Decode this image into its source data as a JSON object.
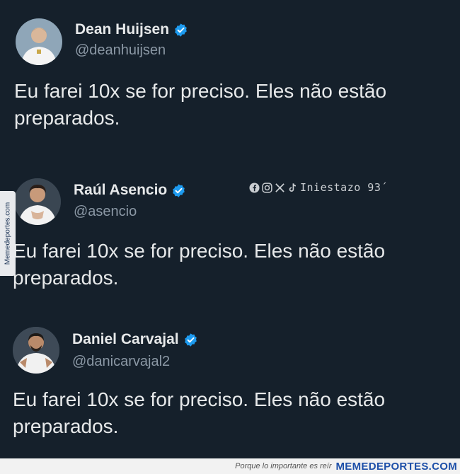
{
  "tweets": [
    {
      "name": "Dean Huijsen",
      "handle": "@deanhuijsen",
      "text": "Eu farei 10x se for preciso. Eles não estão preparados."
    },
    {
      "name": "Raúl Asencio",
      "handle": "@asencio",
      "text": "Eu farei 10x se for preciso. Eles não estão preparados."
    },
    {
      "name": "Daniel Carvajal",
      "handle": "@danicarvajal2",
      "text": "Eu farei 10x se for preciso. Eles não estão preparados."
    }
  ],
  "watermark": {
    "text": "Iniestazo 93´",
    "icons": [
      "facebook-icon",
      "instagram-icon",
      "x-icon",
      "tiktok-icon"
    ]
  },
  "side_tab": {
    "text": "Memedeportes.com"
  },
  "footer": {
    "slogan": "Porque lo importante es reír",
    "brand": "MEMEDEPORTES.COM"
  },
  "colors": {
    "background": "#15202b",
    "verified": "#1d9bf0",
    "handle": "#8b98a5",
    "text": "#e7e9ea"
  }
}
